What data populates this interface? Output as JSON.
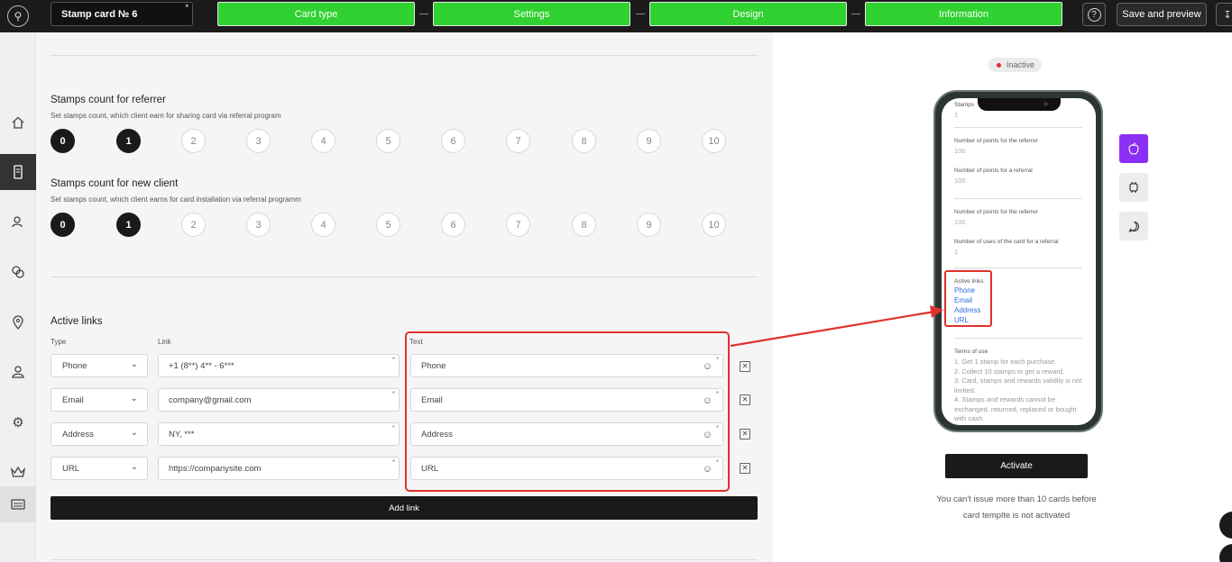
{
  "header": {
    "card_name": "Stamp card № 6",
    "steps": [
      "Card type",
      "Settings",
      "Design",
      "Information"
    ],
    "help_label": "?",
    "save_label": "Save and preview"
  },
  "referrer": {
    "title": "Stamps count for referrer",
    "subtitle": "Set stamps count, which client earn for sharing card via referral program",
    "options": [
      "0",
      "1",
      "2",
      "3",
      "4",
      "5",
      "6",
      "7",
      "8",
      "9",
      "10"
    ],
    "selected_filled": [
      "0",
      "1"
    ]
  },
  "new_client": {
    "title": "Stamps count for new client",
    "subtitle": "Set stamps count, which client earns for card installation via referral programm",
    "options": [
      "0",
      "1",
      "2",
      "3",
      "4",
      "5",
      "6",
      "7",
      "8",
      "9",
      "10"
    ],
    "selected_filled": [
      "0",
      "1"
    ]
  },
  "links": {
    "title": "Active links",
    "col_type": "Type",
    "col_link": "Link",
    "col_text": "Text",
    "rows": [
      {
        "type": "Phone",
        "link": "+1 (8**) 4** - 6***",
        "text": "Phone"
      },
      {
        "type": "Email",
        "link": "company@gmail.com",
        "text": "Email"
      },
      {
        "type": "Address",
        "link": "NY, ***",
        "text": "Address"
      },
      {
        "type": "URL",
        "link": "https://companysite.com",
        "text": "URL"
      }
    ],
    "add_label": "Add link"
  },
  "preview": {
    "status": "Inactive",
    "phone": {
      "top_label": "Stamps",
      "top_value": "1",
      "points_referrer_label": "Number of points for the referrer",
      "points_referrer_value": "100",
      "points_referral_label": "Number of points for a referral",
      "points_referral_value": "100",
      "points_referrer_label_2": "Number of points for the referrer",
      "points_referrer_value_2": "100",
      "uses_label": "Number of uses of the card for a referral",
      "uses_value": "1",
      "active_links_label": "Active links",
      "active_links": [
        "Phone",
        "Email",
        "Address",
        "URL"
      ],
      "terms_label": "Terms of use",
      "terms_text": "1. Get 1 stamp for each purchase.\n2. Collect 10 stamps to get a reward.\n3. Card, stamps and rewards validity is not limited.\n4. Stamps and rewards cannot be exchanged, returned, replaced or bought with cash."
    },
    "activate_label": "Activate",
    "warning_line1": "You can't issue more than 10 cards before",
    "warning_line2": "card templte is not activated"
  },
  "colors": {
    "accent_green": "#2fd230",
    "highlight_red": "#e0312b",
    "platform_purple": "#8b2ff5",
    "link_blue": "#2d6de0"
  },
  "icons": {
    "sidebar": [
      "home-icon",
      "card-icon",
      "clients-icon",
      "chat-icon",
      "location-icon",
      "user-icon",
      "gear-icon",
      "crown-icon",
      "template-icon"
    ],
    "platforms": [
      "apple-icon",
      "android-icon",
      "chat-bubble-icon"
    ]
  }
}
